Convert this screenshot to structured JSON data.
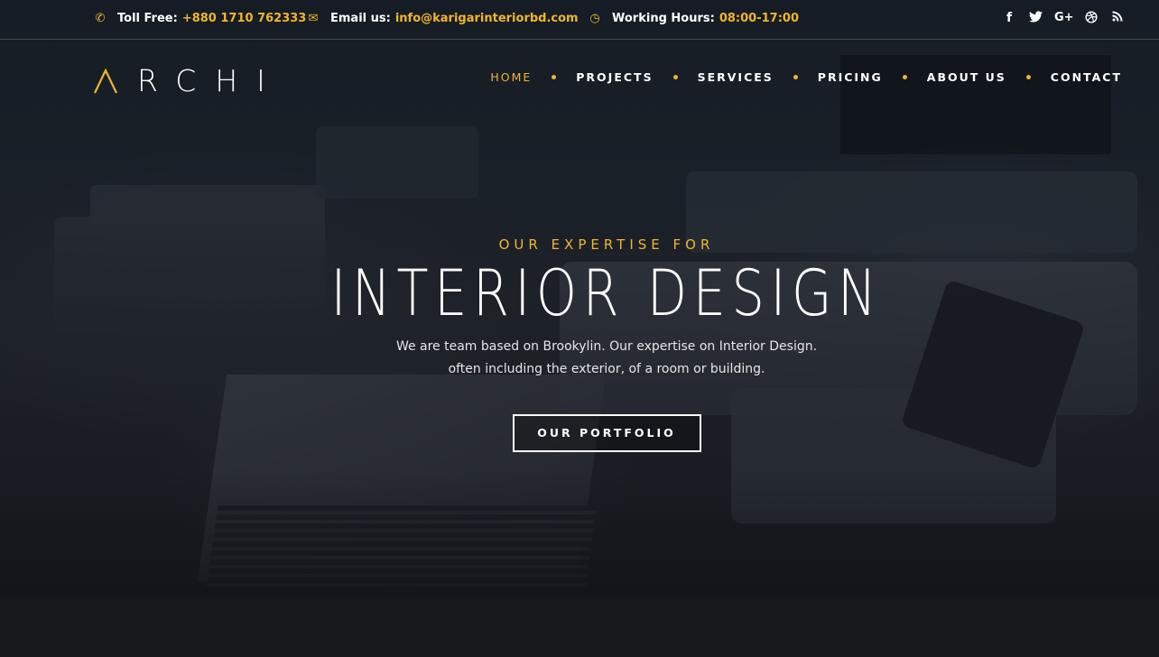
{
  "topbar": {
    "phone": {
      "icon": "phone-icon",
      "label": "Toll Free:",
      "value": "+880 1710 762333"
    },
    "email": {
      "icon": "envelope-icon",
      "label": "Email us:",
      "value": "info@karigarinteriorbd.com"
    },
    "hours": {
      "icon": "clock-icon",
      "label": "Working Hours:",
      "value": "08:00-17:00"
    },
    "social": [
      {
        "icon": "facebook-icon",
        "glyph": "f"
      },
      {
        "icon": "twitter-icon",
        "glyph": "🐦"
      },
      {
        "icon": "google-plus-icon",
        "glyph": "G+"
      },
      {
        "icon": "dribbble-icon",
        "glyph": "◎"
      },
      {
        "icon": "rss-icon",
        "glyph": "⦚"
      }
    ]
  },
  "header": {
    "logo_text": "RCHI",
    "nav": [
      {
        "label": "HOME",
        "active": true
      },
      {
        "label": "PROJECTS",
        "active": false
      },
      {
        "label": "SERVICES",
        "active": false
      },
      {
        "label": "PRICING",
        "active": false
      },
      {
        "label": "ABOUT US",
        "active": false
      },
      {
        "label": "CONTACT",
        "active": false
      }
    ]
  },
  "hero": {
    "eyebrow": "OUR EXPERTISE FOR",
    "headline": "INTERIOR DESIGN",
    "sub_line1": "We are team based on Brookylin. Our expertise on Interior Design.",
    "sub_line2": "often including the exterior, of a room or building.",
    "cta": "OUR PORTFOLIO"
  },
  "colors": {
    "accent": "#f1b52d",
    "text": "#ffffff",
    "band": "#18191b"
  }
}
